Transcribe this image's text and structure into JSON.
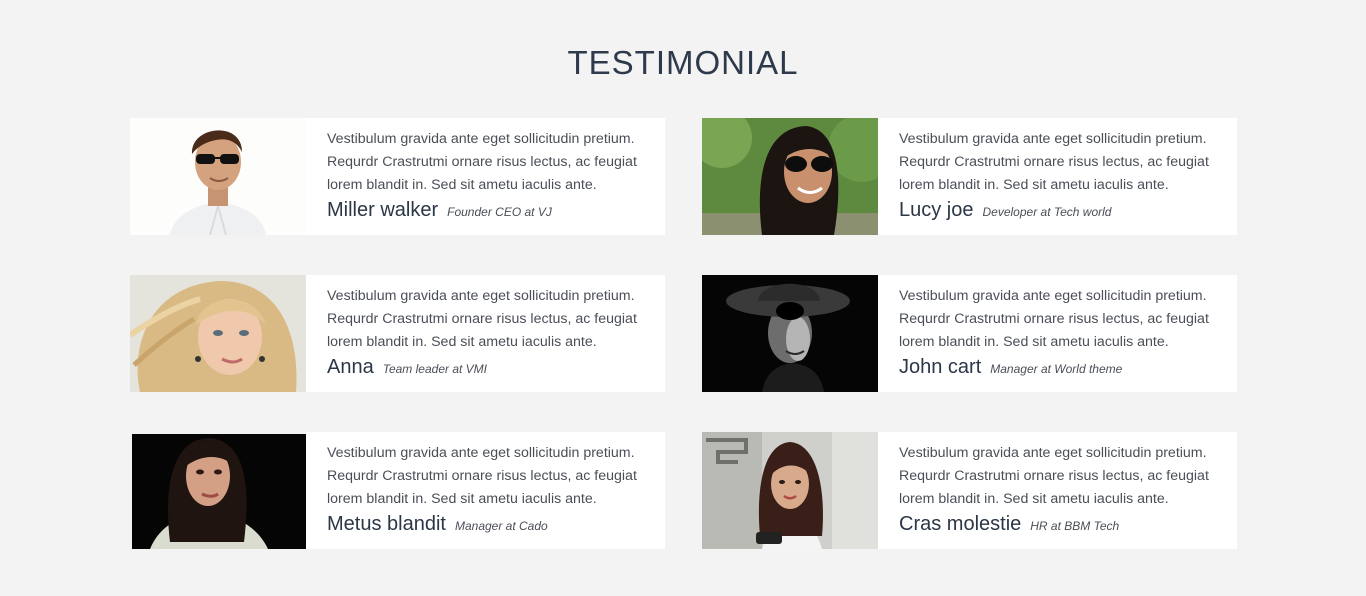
{
  "section": {
    "title": "TESTIMONIAL"
  },
  "testimonials": [
    {
      "quote": "Vestibulum gravida ante eget sollicitudin pretium. Requrdr Crastrutmi ornare risus lectus, ac feugiat lorem blandit in. Sed sit ametu iaculis ante.",
      "name": "Miller walker",
      "role": "Founder CEO at VJ"
    },
    {
      "quote": "Vestibulum gravida ante eget sollicitudin pretium. Requrdr Crastrutmi ornare risus lectus, ac feugiat lorem blandit in. Sed sit ametu iaculis ante.",
      "name": "Lucy joe",
      "role": "Developer at Tech world"
    },
    {
      "quote": "Vestibulum gravida ante eget sollicitudin pretium. Requrdr Crastrutmi ornare risus lectus, ac feugiat lorem blandit in. Sed sit ametu iaculis ante.",
      "name": "Anna",
      "role": "Team leader at VMI"
    },
    {
      "quote": "Vestibulum gravida ante eget sollicitudin pretium. Requrdr Crastrutmi ornare risus lectus, ac feugiat lorem blandit in. Sed sit ametu iaculis ante.",
      "name": "John cart",
      "role": "Manager at World theme"
    },
    {
      "quote": "Vestibulum gravida ante eget sollicitudin pretium. Requrdr Crastrutmi ornare risus lectus, ac feugiat lorem blandit in. Sed sit ametu iaculis ante.",
      "name": "Metus blandit",
      "role": "Manager at Cado"
    },
    {
      "quote": "Vestibulum gravida ante eget sollicitudin pretium. Requrdr Crastrutmi ornare risus lectus, ac feugiat lorem blandit in. Sed sit ametu iaculis ante.",
      "name": "Cras molestie",
      "role": "HR at BBM Tech"
    }
  ],
  "colors": {
    "page_background": "#f3f3f3",
    "card_background": "#ffffff",
    "title_text": "#2e3a4b",
    "body_text": "#4a4f57"
  }
}
